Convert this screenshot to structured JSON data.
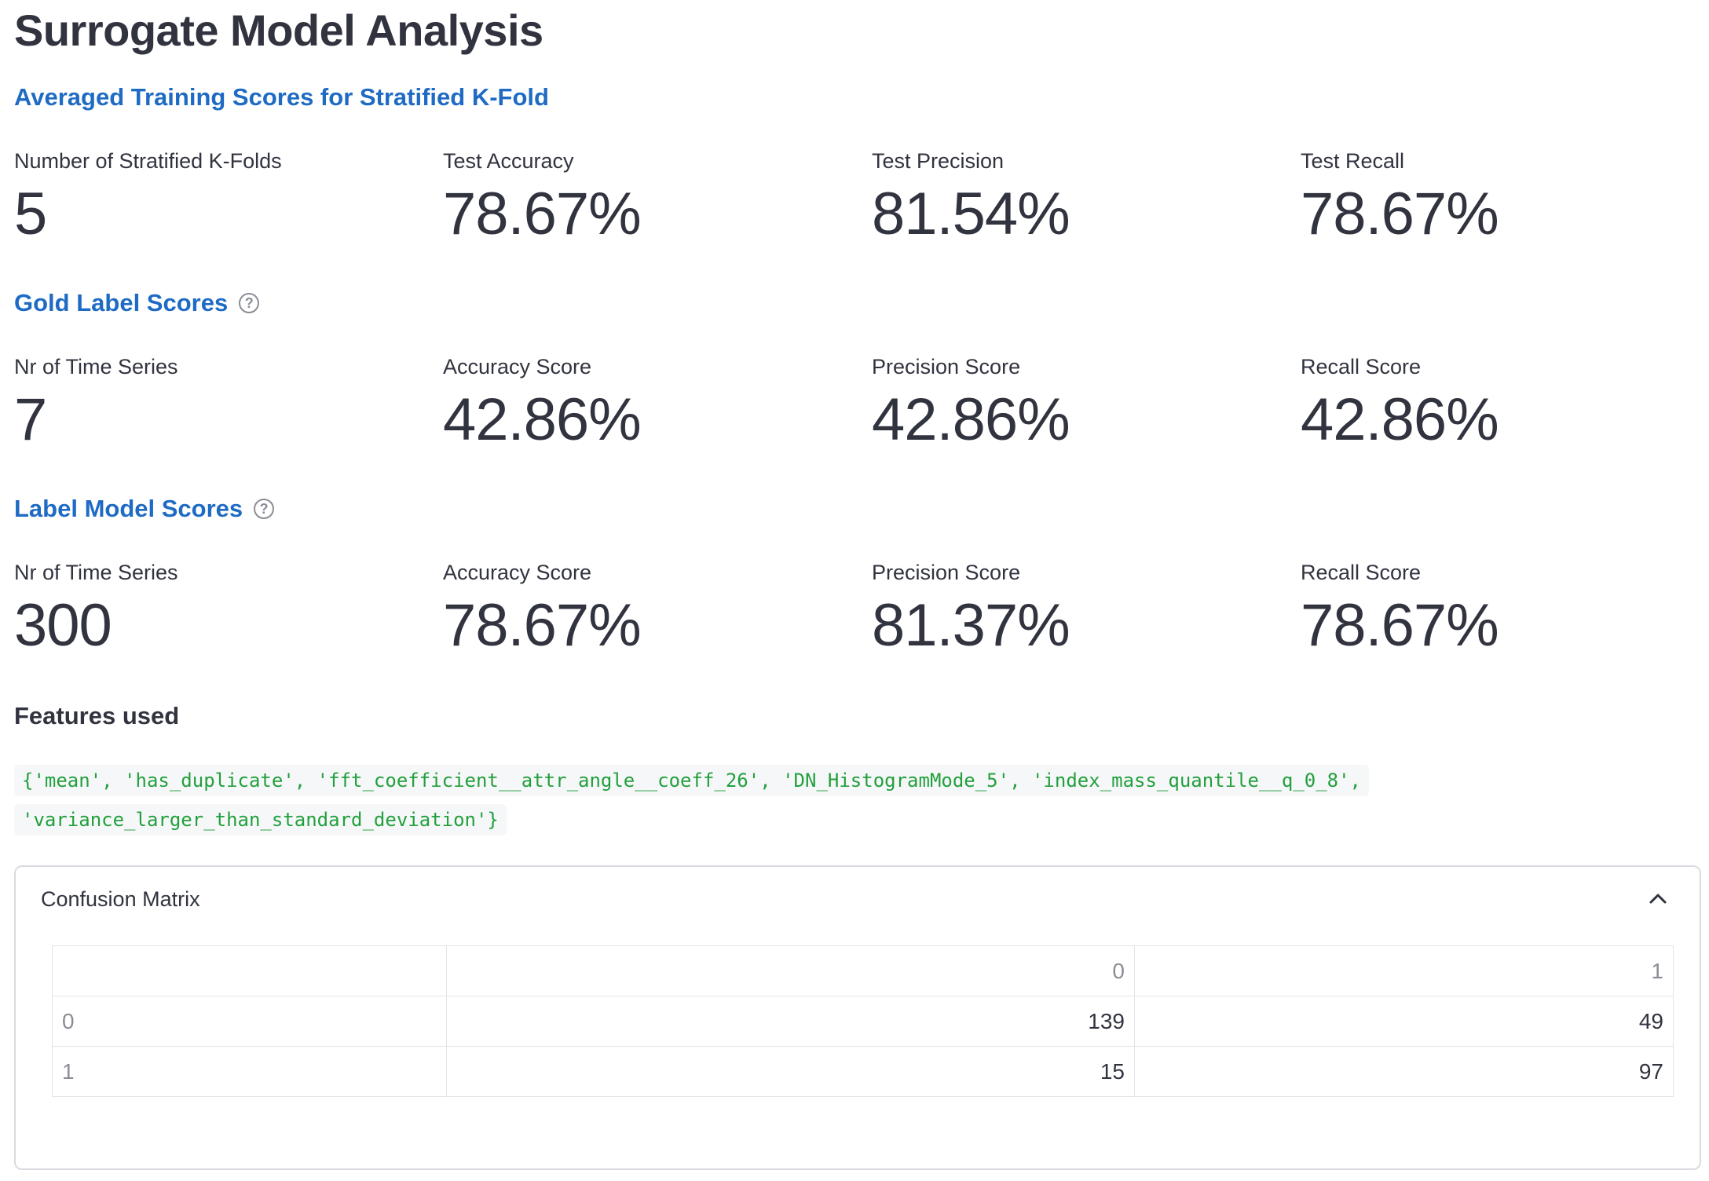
{
  "title": "Surrogate Model Analysis",
  "sections": {
    "training": {
      "heading": "Averaged Training Scores for Stratified K-Fold",
      "metrics": [
        {
          "label": "Number of Stratified K-Folds",
          "value": "5"
        },
        {
          "label": "Test Accuracy",
          "value": "78.67%"
        },
        {
          "label": "Test Precision",
          "value": "81.54%"
        },
        {
          "label": "Test Recall",
          "value": "78.67%"
        }
      ]
    },
    "gold": {
      "heading": "Gold Label Scores",
      "help_icon": "question-circle-icon",
      "metrics": [
        {
          "label": "Nr of Time Series",
          "value": "7"
        },
        {
          "label": "Accuracy Score",
          "value": "42.86%"
        },
        {
          "label": "Precision Score",
          "value": "42.86%"
        },
        {
          "label": "Recall Score",
          "value": "42.86%"
        }
      ]
    },
    "label_model": {
      "heading": "Label Model Scores",
      "help_icon": "question-circle-icon",
      "metrics": [
        {
          "label": "Nr of Time Series",
          "value": "300"
        },
        {
          "label": "Accuracy Score",
          "value": "78.67%"
        },
        {
          "label": "Precision Score",
          "value": "81.37%"
        },
        {
          "label": "Recall Score",
          "value": "78.67%"
        }
      ]
    }
  },
  "features": {
    "label": "Features used",
    "code_line1": "{'mean', 'has_duplicate', 'fft_coefficient__attr_angle__coeff_26', 'DN_HistogramMode_5', 'index_mass_quantile__q_0_8',",
    "code_line2": "'variance_larger_than_standard_deviation'}"
  },
  "confusion_matrix": {
    "title": "Confusion Matrix",
    "icon": "chevron-up-icon",
    "columns": [
      "",
      "0",
      "1"
    ],
    "rows": [
      {
        "index": "0",
        "values": [
          "139",
          "49"
        ]
      },
      {
        "index": "1",
        "values": [
          "15",
          "97"
        ]
      }
    ]
  },
  "colors": {
    "heading_blue": "#1f6bc4",
    "code_green": "#22a03c",
    "text": "#31333f"
  }
}
